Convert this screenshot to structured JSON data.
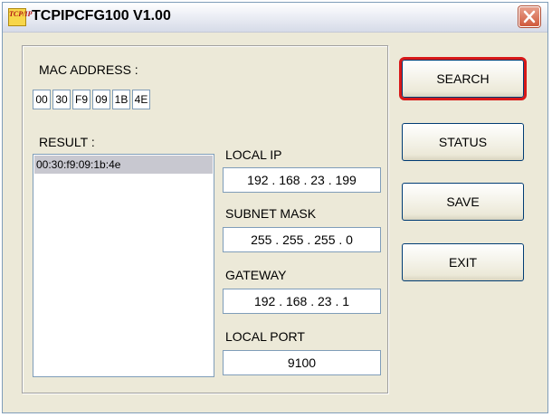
{
  "window": {
    "title": "TCPIPCFG100 V1.00",
    "icon_label": "TCP/IP"
  },
  "mac_address": {
    "label": "MAC ADDRESS :",
    "octets": [
      "00",
      "30",
      "F9",
      "09",
      "1B",
      "4E"
    ]
  },
  "result": {
    "label": "RESULT :",
    "items": [
      "00:30:f9:09:1b:4e"
    ]
  },
  "fields": {
    "local_ip_label": "LOCAL IP",
    "local_ip_value": "192 . 168 .  23 . 199",
    "subnet_mask_label": "SUBNET MASK",
    "subnet_mask_value": "255 . 255 . 255 .  0",
    "gateway_label": "GATEWAY",
    "gateway_value": "192 . 168 .  23 .  1",
    "local_port_label": "LOCAL PORT",
    "local_port_value": "9100"
  },
  "buttons": {
    "search": "SEARCH",
    "status": "STATUS",
    "save": "SAVE",
    "exit": "EXIT"
  },
  "colors": {
    "highlight_outline": "#d81818",
    "window_bg": "#ece9d8",
    "selected_row": "#c8c8d0"
  },
  "icons": {
    "app": "tcpip-app-icon",
    "close": "close-icon"
  }
}
